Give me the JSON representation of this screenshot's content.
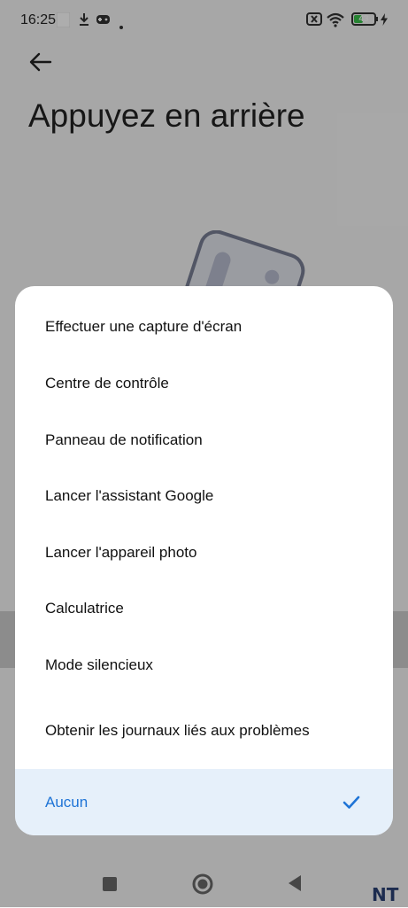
{
  "status_bar": {
    "time": "16:25",
    "battery_level": "43",
    "icons": [
      "download-icon",
      "gamepad-icon",
      "dot-icon",
      "no-sim-icon",
      "wifi-icon",
      "battery-icon",
      "charging-icon"
    ]
  },
  "page": {
    "title": "Appuyez en arrière"
  },
  "sheet": {
    "options": [
      {
        "label": "Effectuer une capture d'écran",
        "selected": false
      },
      {
        "label": "Centre de contrôle",
        "selected": false
      },
      {
        "label": "Panneau de notification",
        "selected": false
      },
      {
        "label": "Lancer l'assistant Google",
        "selected": false
      },
      {
        "label": "Lancer l'appareil photo",
        "selected": false
      },
      {
        "label": "Calculatrice",
        "selected": false
      },
      {
        "label": "Mode silencieux",
        "selected": false
      },
      {
        "label": "Obtenir les journaux liés aux problèmes",
        "selected": false
      },
      {
        "label": "Aucun",
        "selected": true
      }
    ],
    "accent_color": "#1f74d6",
    "selected_bg_color": "#e6f0fa"
  },
  "nav_bar": {
    "buttons": [
      "recents-button",
      "home-button",
      "back-nav-button"
    ]
  },
  "watermark": {
    "text": "NT"
  }
}
